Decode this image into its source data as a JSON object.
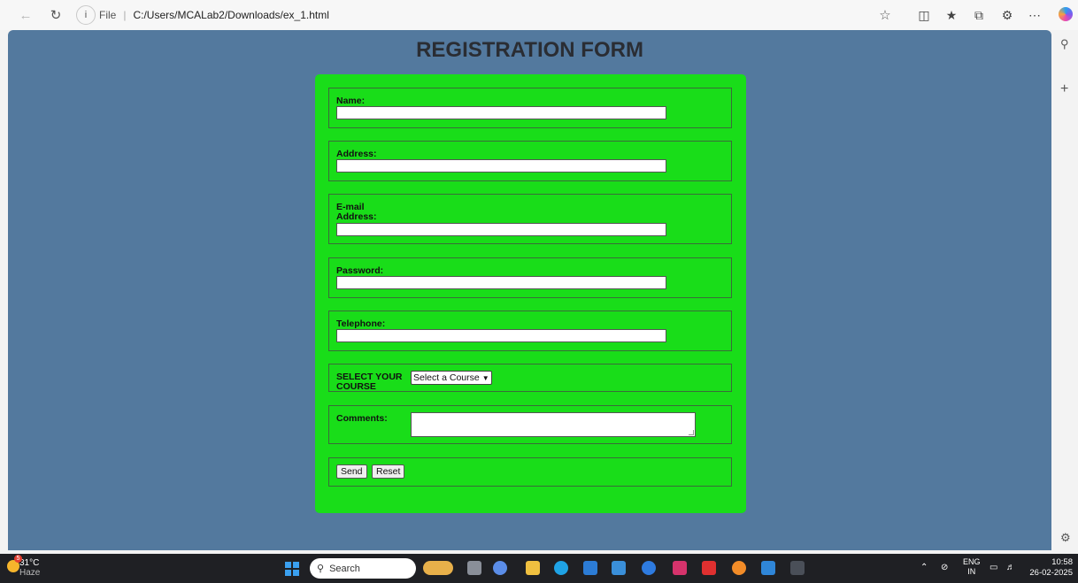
{
  "browser": {
    "address_file_label": "File",
    "address_url": "C:/Users/MCALab2/Downloads/ex_1.html"
  },
  "page": {
    "title": "REGISTRATION FORM",
    "fields": {
      "name_label": "Name:",
      "address_label": "Address:",
      "email_label_line1": "E-mail",
      "email_label_line2": "Address:",
      "password_label": "Password:",
      "telephone_label": "Telephone:",
      "course_label_line1": "SELECT YOUR",
      "course_label_line2": "COURSE",
      "course_select_value": "Select a Course",
      "comments_label": "Comments:"
    },
    "buttons": {
      "send": "Send",
      "reset": "Reset"
    },
    "colors": {
      "page_background": "#53799e",
      "form_background": "#19dd19",
      "title_text": "#2a2d33"
    }
  },
  "taskbar": {
    "weather_temp": "31°C",
    "weather_condition": "Haze",
    "weather_badge": "5",
    "search_placeholder": "Search",
    "language_line1": "ENG",
    "language_line2": "IN",
    "time": "10:58",
    "date": "26-02-2025"
  }
}
